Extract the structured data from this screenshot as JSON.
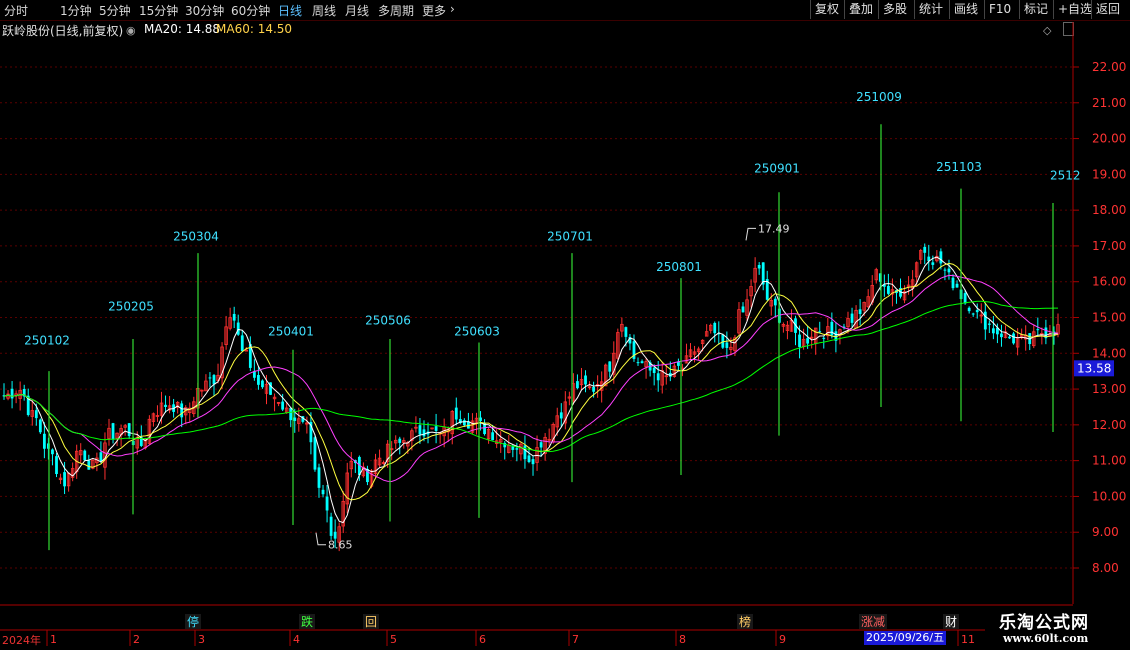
{
  "toolbar": {
    "periods": [
      "分时",
      "1分钟",
      "5分钟",
      "15分钟",
      "30分钟",
      "60分钟",
      "日线",
      "周线",
      "月线",
      "多周期",
      "更多"
    ],
    "active_period": "日线",
    "buttons": [
      "复权",
      "叠加",
      "多股",
      "统计",
      "画线",
      "F10",
      "标记",
      "+自选",
      "返回"
    ]
  },
  "info": {
    "stock_name": "跃岭股份(日线,前复权)",
    "ma20": "MA20: 14.88",
    "ma60": "MA60: 14.50"
  },
  "colors": {
    "up": "#ff3030",
    "down": "#00ffff",
    "ma_white": "#ffffff",
    "ma_yellow": "#ffff40",
    "ma_magenta": "#ff40ff",
    "ma_green": "#00ff00",
    "grid": "#5a0000",
    "axis_text": "#ff3333",
    "marker_line": "#33dd33",
    "marker_label": "#40e0ff",
    "price_box": "#1a1ad8"
  },
  "chart_data": {
    "type": "candlestick",
    "y_axis": {
      "ticks": [
        "22.00",
        "21.00",
        "20.00",
        "19.00",
        "18.00",
        "17.00",
        "16.00",
        "15.00",
        "14.00",
        "13.00",
        "12.00",
        "11.00",
        "10.00",
        "9.00",
        "8.00"
      ],
      "range": [
        7.5,
        22.5
      ]
    },
    "x_axis": {
      "year_label": "2024年",
      "month_labels": [
        "1",
        "2",
        "3",
        "4",
        "5",
        "6",
        "7",
        "8",
        "9",
        "11"
      ]
    },
    "current_price": "13.58",
    "annotations": {
      "high": {
        "value": 17.49,
        "label": "17.49"
      },
      "low": {
        "value": 8.65,
        "label": "8.65"
      }
    },
    "period_markers": [
      {
        "label": "250102",
        "top": 13.5,
        "bottom": 8.5
      },
      {
        "label": "250205",
        "top": 14.4,
        "bottom": 9.5
      },
      {
        "label": "250304",
        "top": 16.8,
        "bottom": 12.2
      },
      {
        "label": "250401",
        "top": 14.1,
        "bottom": 9.2
      },
      {
        "label": "250506",
        "top": 14.4,
        "bottom": 9.3
      },
      {
        "label": "250603",
        "top": 14.3,
        "bottom": 9.4
      },
      {
        "label": "250701",
        "top": 16.8,
        "bottom": 10.4
      },
      {
        "label": "250801",
        "top": 16.1,
        "bottom": 10.6
      },
      {
        "label": "250901",
        "top": 18.5,
        "bottom": 11.7
      },
      {
        "label": "251009",
        "top": 20.4,
        "bottom": 12.5
      },
      {
        "label": "251103",
        "top": 18.6,
        "bottom": 12.1
      },
      {
        "label": "2512",
        "top": 18.2,
        "bottom": 11.8
      }
    ],
    "anchors": [
      12.8,
      13.0,
      12.2,
      11.2,
      10.4,
      11.3,
      10.8,
      11.7,
      11.9,
      11.4,
      12.4,
      12.6,
      12.3,
      13.0,
      13.3,
      15.2,
      13.9,
      13.1,
      12.8,
      12.3,
      11.9,
      10.1,
      8.9,
      10.9,
      10.6,
      11.1,
      11.4,
      11.7,
      11.9,
      11.7,
      12.3,
      12.1,
      11.9,
      11.6,
      11.4,
      11.1,
      11.7,
      12.4,
      13.1,
      13.0,
      13.5,
      14.9,
      13.8,
      13.5,
      13.3,
      13.6,
      14.1,
      14.6,
      14.0,
      15.1,
      16.3,
      15.3,
      14.8,
      14.3,
      14.7,
      14.5,
      14.9,
      15.2,
      16.2,
      15.6,
      15.9,
      16.9,
      16.6,
      16.0,
      15.4,
      14.9,
      14.6,
      14.4,
      14.3,
      14.6,
      14.7
    ],
    "events": [
      {
        "label": "停",
        "color": "#40e0ff"
      },
      {
        "label": "跌",
        "color": "#40ff40"
      },
      {
        "label": "回",
        "color": "#ffcc66"
      },
      {
        "label": "榜",
        "color": "#ffcc66"
      },
      {
        "label": "涨减",
        "color": "#ff6060"
      },
      {
        "label": "财",
        "color": "#ffffff"
      }
    ],
    "cursor_date": "2025/09/26/五"
  },
  "brand": {
    "name": "乐淘公式网",
    "url": "www.60lt.com"
  }
}
